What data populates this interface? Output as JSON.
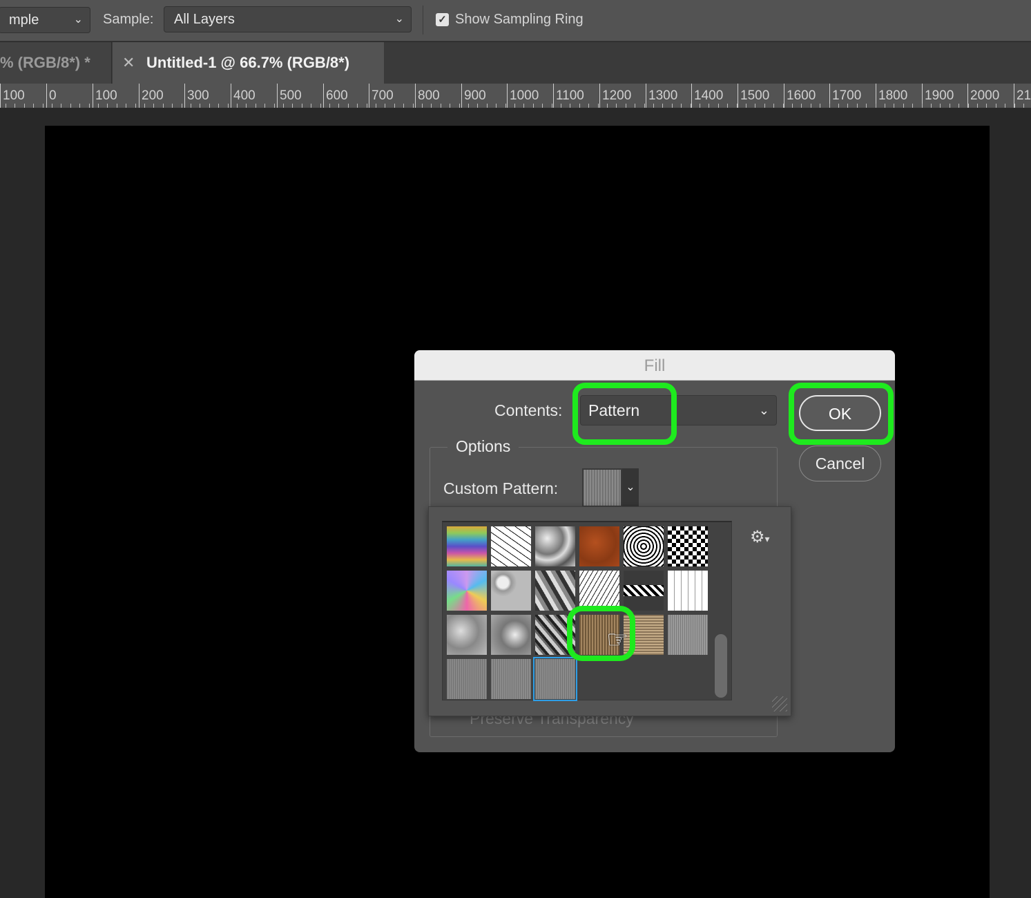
{
  "options_bar": {
    "sample_size_value": "mple",
    "sample_label": "Sample:",
    "sample_value": "All Layers",
    "show_sampling_ring_label": "Show Sampling Ring",
    "show_sampling_ring_checked": true
  },
  "tabs": [
    {
      "label": "% (RGB/8*) *",
      "active": false
    },
    {
      "label": "Untitled-1 @ 66.7% (RGB/8*)",
      "active": true
    }
  ],
  "ruler": {
    "labels": [
      "100",
      "0",
      "100",
      "200",
      "300",
      "400",
      "500",
      "600",
      "700",
      "800",
      "900",
      "1000",
      "1100",
      "1200",
      "1300",
      "1400",
      "1500",
      "1600",
      "1700",
      "1800",
      "1900",
      "2000",
      "21"
    ]
  },
  "fill_dialog": {
    "title": "Fill",
    "contents_label": "Contents:",
    "contents_value": "Pattern",
    "ok_label": "OK",
    "cancel_label": "Cancel",
    "options_label": "Options",
    "custom_pattern_label": "Custom Pattern:",
    "preserve_transparency_label": "Preserve Transparency"
  },
  "pattern_picker": {
    "patterns": [
      "rainbow-gradient",
      "black-ink-lines",
      "crumpled-paper",
      "rust-orange",
      "concentric-squares",
      "checkerboard",
      "colorful-foil",
      "gray-bubbles",
      "triangles-mosaic",
      "cracked-lines",
      "zigzag-stripe",
      "white-tiles",
      "gray-clouds",
      "gray-blobs",
      "gray-chain-links",
      "brown-burlap",
      "tan-weave",
      "gray-fabric",
      "gray-linen-1",
      "gray-linen-2",
      "gray-linen-3"
    ],
    "selected_index": 20,
    "hovered_index": 15
  },
  "colors": {
    "highlight": "#1eea1e",
    "selection": "#2e9fe8"
  }
}
